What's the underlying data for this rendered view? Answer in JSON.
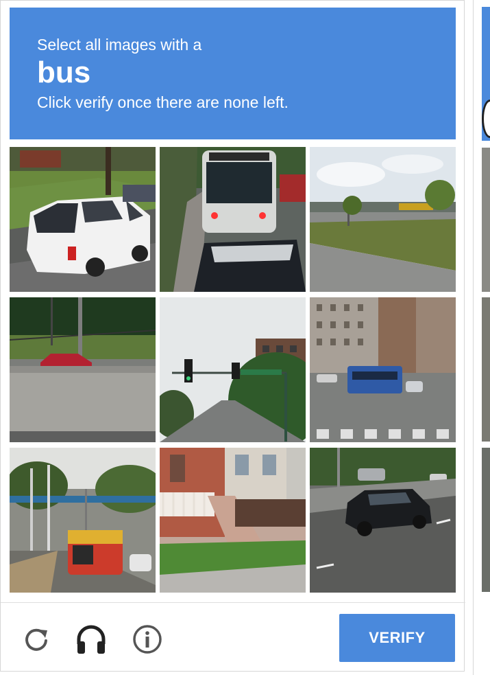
{
  "challenge": {
    "instruction_line1": "Select all images with a",
    "target_object": "bus",
    "instruction_line3": "Click verify once there are none left."
  },
  "tiles": [
    {
      "index": 1,
      "scene": "white minivan on street"
    },
    {
      "index": 2,
      "scene": "front of a transit bus behind a car"
    },
    {
      "index": 3,
      "scene": "grass median along a road"
    },
    {
      "index": 4,
      "scene": "red car behind concrete wall"
    },
    {
      "index": 5,
      "scene": "traffic light over road"
    },
    {
      "index": 6,
      "scene": "blue bus near apartment buildings"
    },
    {
      "index": 7,
      "scene": "red bus at a station"
    },
    {
      "index": 8,
      "scene": "brick house with steps"
    },
    {
      "index": 9,
      "scene": "black SUV on highway"
    }
  ],
  "footer": {
    "reload_icon": "reload-icon",
    "audio_icon": "headphones-icon",
    "info_icon": "info-icon",
    "verify_label": "VERIFY"
  },
  "colors": {
    "accent": "#4a89dc",
    "icon": "#555555"
  }
}
